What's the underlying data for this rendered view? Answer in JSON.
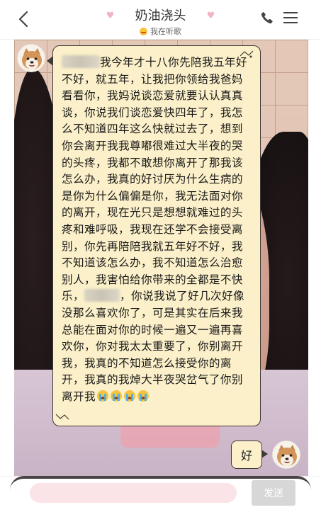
{
  "header": {
    "title": "奶油浇头",
    "status": "我在听歌",
    "icons": {
      "back": "chevron-left-icon",
      "phone": "phone-icon",
      "menu": "menu-icon",
      "heart_left": "heart-icon",
      "heart_right": "heart-icon",
      "status": "smiling-emoji-icon"
    }
  },
  "messages": [
    {
      "side": "left",
      "sender_avatar": "shiba-dog-avatar",
      "segments": {
        "part1": "我今年才十八你先陪我五年好不好，就五年，让我把你领给我爸妈看看你，我妈说谈恋爱就要认认真真谈，你说我们谈恋爱快四年了，我怎么不知道四年这么快就过去了，想到你会离开我我尊嘟很难过大半夜的哭的头疼，我都不敢想你离开了那我该怎么办，我真的好讨厌为什么生病的是你为什么偏偏是你，我无法面对你的离开，现在光只是想想就难过的头疼和难呼吸，我现在还学不会接受离别，你先再陪陪我就五年好不好，我不知道该怎么办，我不知道怎么治愈别人，我害怕给你带来的全都是不快乐，",
        "part2": "，你说我说了好几次好像没那么喜欢你了，可是其实在后来我总能在面对你的时候一遍又一遍再喜欢你，你对我太太重要了，你别离开我，我真的不知道怎么接受你的离开，我真的我焯大半夜哭岔气了你别离开我"
      },
      "blurred_name_count": 2,
      "trailing_emoji": "crying-emoji-icon",
      "trailing_emoji_count": 4
    },
    {
      "side": "right",
      "sender_avatar": "shiba-dog-avatar",
      "text": "好"
    }
  ],
  "composer": {
    "input_value": "",
    "placeholder": "",
    "send_label": "发送"
  },
  "colors": {
    "bubble_fill": "#fbf0c9",
    "bubble_border": "#3e3a36",
    "input_fill": "#fbe4e7",
    "send_button": "#d7d7d7",
    "heart": "#f3b3c2"
  }
}
